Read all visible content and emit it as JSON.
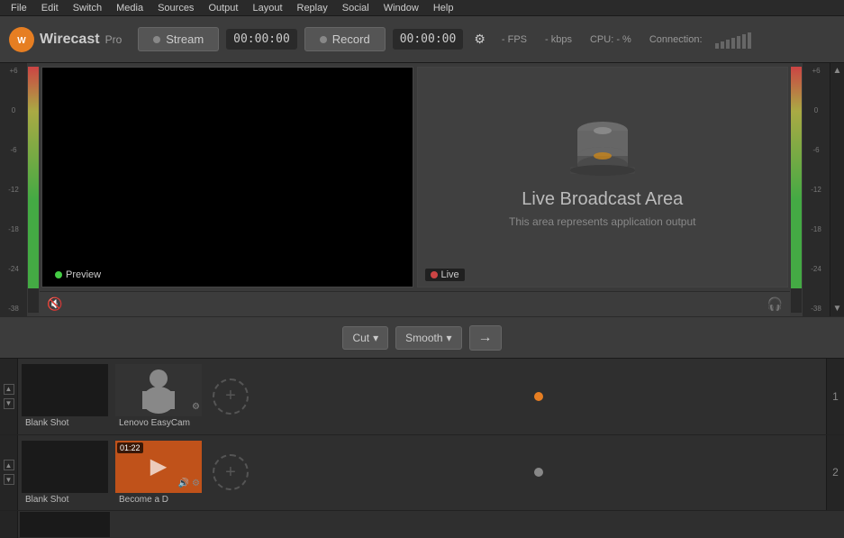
{
  "app": {
    "title": "Wirecast Pro"
  },
  "menu": {
    "items": [
      {
        "id": "file",
        "label": "File"
      },
      {
        "id": "edit",
        "label": "Edit"
      },
      {
        "id": "switch",
        "label": "Switch"
      },
      {
        "id": "media",
        "label": "Media"
      },
      {
        "id": "sources",
        "label": "Sources"
      },
      {
        "id": "output",
        "label": "Output"
      },
      {
        "id": "layout",
        "label": "Layout"
      },
      {
        "id": "replay",
        "label": "Replay"
      },
      {
        "id": "social",
        "label": "Social"
      },
      {
        "id": "window",
        "label": "Window"
      },
      {
        "id": "help",
        "label": "Help"
      }
    ]
  },
  "toolbar": {
    "logo_text": "Wirecast",
    "logo_pro": "Pro",
    "stream_label": "Stream",
    "stream_time": "00:00:00",
    "record_label": "Record",
    "record_time": "00:00:00",
    "fps_label": "- FPS",
    "kbps_label": "- kbps",
    "cpu_label": "CPU: - %",
    "connection_label": "Connection:"
  },
  "preview_panel": {
    "label": "Preview"
  },
  "live_panel": {
    "title": "Live Broadcast Area",
    "subtitle": "This area represents application output",
    "label": "Live"
  },
  "transition": {
    "cut_label": "Cut",
    "smooth_label": "Smooth"
  },
  "vu_labels": [
    "+6",
    "0",
    "-6",
    "-12",
    "-18",
    "-24",
    "-38"
  ],
  "layers": [
    {
      "id": "layer1",
      "number": "1",
      "shots": [
        {
          "id": "blank1",
          "label": "Blank Shot",
          "type": "blank"
        },
        {
          "id": "camera1",
          "label": "Lenovo EasyCam",
          "type": "camera",
          "has_settings": true
        }
      ]
    },
    {
      "id": "layer2",
      "number": "2",
      "shots": [
        {
          "id": "blank2",
          "label": "Blank Shot",
          "type": "blank"
        },
        {
          "id": "member1",
          "label": "Become a D",
          "type": "orange",
          "time": "01:22",
          "has_audio": true,
          "has_settings": true
        }
      ]
    }
  ],
  "icons": {
    "settings": "⚙",
    "audio": "🔊",
    "mute_left": "🔇",
    "headphones": "🎧",
    "plus": "+",
    "arrow_right": "→",
    "chevron_down": "▾",
    "chevron_up": "▴",
    "scroll_up": "▲",
    "scroll_down": "▼"
  }
}
